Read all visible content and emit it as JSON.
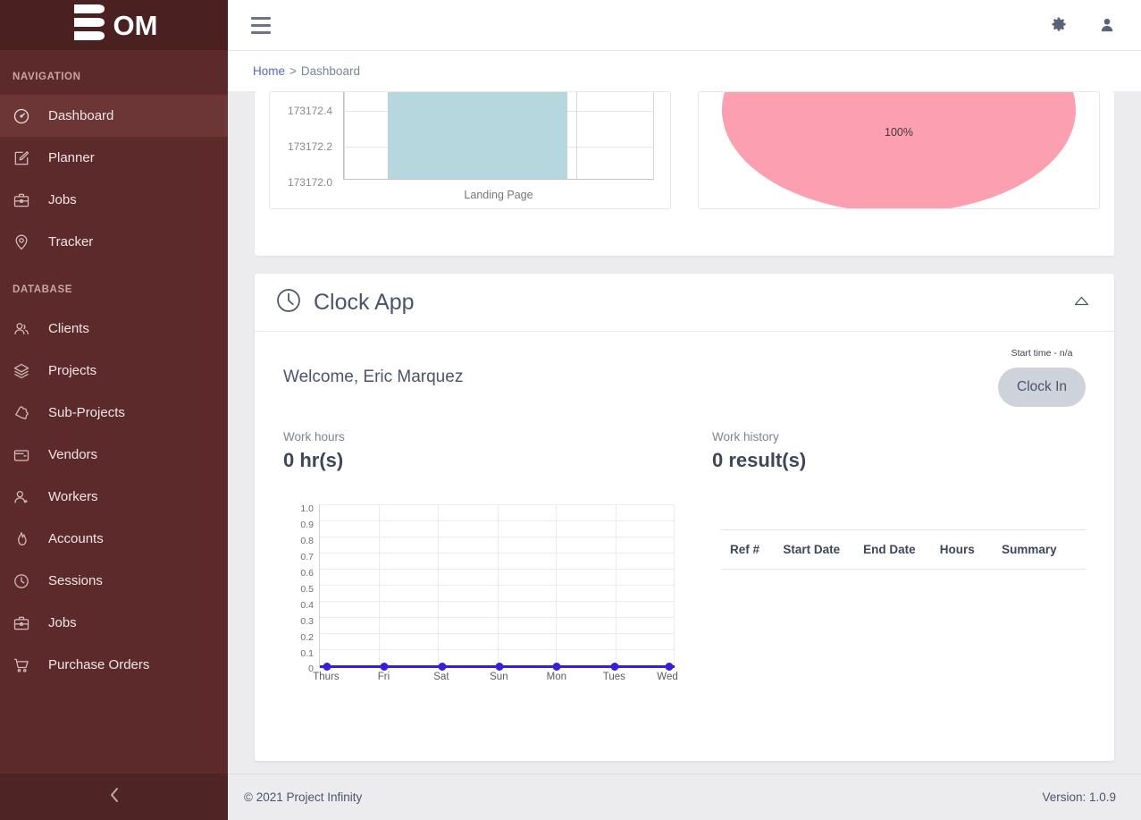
{
  "brand": {
    "logo_text": "OM",
    "logo_icon": "stacked-bars-icon"
  },
  "sidebar": {
    "sections": [
      {
        "title": "NAVIGATION",
        "items": [
          {
            "label": "Dashboard",
            "icon": "speedometer-icon",
            "active": true
          },
          {
            "label": "Planner",
            "icon": "edit-square-icon",
            "active": false
          },
          {
            "label": "Jobs",
            "icon": "briefcase-icon",
            "active": false
          },
          {
            "label": "Tracker",
            "icon": "map-pin-icon",
            "active": false
          }
        ]
      },
      {
        "title": "DATABASE",
        "items": [
          {
            "label": "Clients",
            "icon": "users-icon",
            "active": false
          },
          {
            "label": "Projects",
            "icon": "layers-icon",
            "active": false
          },
          {
            "label": "Sub-Projects",
            "icon": "puzzle-icon",
            "active": false
          },
          {
            "label": "Vendors",
            "icon": "folder-icon",
            "active": false
          },
          {
            "label": "Workers",
            "icon": "user-plus-icon",
            "active": false
          },
          {
            "label": "Accounts",
            "icon": "flame-icon",
            "active": false
          },
          {
            "label": "Sessions",
            "icon": "clock-icon",
            "active": false
          },
          {
            "label": "Jobs",
            "icon": "briefcase-icon",
            "active": false
          },
          {
            "label": "Purchase Orders",
            "icon": "shopping-cart-icon",
            "active": false
          }
        ]
      }
    ],
    "collapse_icon": "chevron-left-icon"
  },
  "topbar": {
    "menu_icon": "hamburger-icon",
    "settings_icon": "gear-icon",
    "user_icon": "user-icon"
  },
  "breadcrumb": {
    "home": "Home",
    "separator": ">",
    "current": "Dashboard"
  },
  "clock_app": {
    "title": "Clock App",
    "icon": "clock-icon",
    "collapse_icon": "caret-up-icon",
    "welcome": "Welcome, Eric Marquez",
    "start_time": "Start time - n/a",
    "clock_in_label": "Clock In",
    "work_hours_label": "Work hours",
    "work_hours_value": "0 hr(s)",
    "work_history_label": "Work history",
    "work_history_value": "0 result(s)",
    "table": {
      "columns": [
        "Ref #",
        "Start Date",
        "End Date",
        "Hours",
        "Summary"
      ],
      "rows": []
    }
  },
  "footer": {
    "copyright": "© 2021 Project Infinity",
    "version": "Version: 1.0.9"
  },
  "colors": {
    "sidebar_bg": "#5c2a2a",
    "sidebar_logo_bg": "#4a2020",
    "sidebar_active": "#6d3636",
    "accent_link": "#5664d2",
    "bar_fill": "#b6d7dd",
    "pie_fill": "#fc9fb0",
    "line_color": "#3520d8",
    "button_bg": "#cdd2db",
    "text_dark": "#4a556b"
  },
  "chart_data": [
    {
      "type": "bar",
      "title": "",
      "categories": [
        "Landing Page"
      ],
      "values": [
        173172.5
      ],
      "xlabel": "Landing Page",
      "ylabel": "",
      "ytick_labels": [
        "173172.4",
        "173172.2",
        "173172.0"
      ],
      "ytick_values": [
        173172.4,
        173172.2,
        173172.0
      ],
      "ylim": [
        173172.0,
        173172.5
      ],
      "grid": true,
      "legend": "none",
      "note": "vertically clipped at top of viewport"
    },
    {
      "type": "pie",
      "title": "",
      "labels": [
        "100%"
      ],
      "values": [
        100
      ],
      "data_labels": [
        "100%"
      ],
      "legend": "none",
      "note": "single full slice, vertically clipped at top of viewport"
    },
    {
      "type": "line",
      "title": "",
      "categories": [
        "Thurs",
        "Fri",
        "Sat",
        "Sun",
        "Mon",
        "Tues",
        "Wed"
      ],
      "values": [
        0,
        0,
        0,
        0,
        0,
        0,
        0
      ],
      "xlabel": "",
      "ylabel": "",
      "ytick_labels": [
        "1.0",
        "0.9",
        "0.8",
        "0.7",
        "0.6",
        "0.5",
        "0.4",
        "0.3",
        "0.2",
        "0.1",
        "0"
      ],
      "ytick_values": [
        1.0,
        0.9,
        0.8,
        0.7,
        0.6,
        0.5,
        0.4,
        0.3,
        0.2,
        0.1,
        0
      ],
      "ylim": [
        0,
        1.0
      ],
      "grid": true,
      "legend": "none",
      "series": [
        {
          "name": "Work hours",
          "values": [
            0,
            0,
            0,
            0,
            0,
            0,
            0
          ]
        }
      ]
    }
  ]
}
